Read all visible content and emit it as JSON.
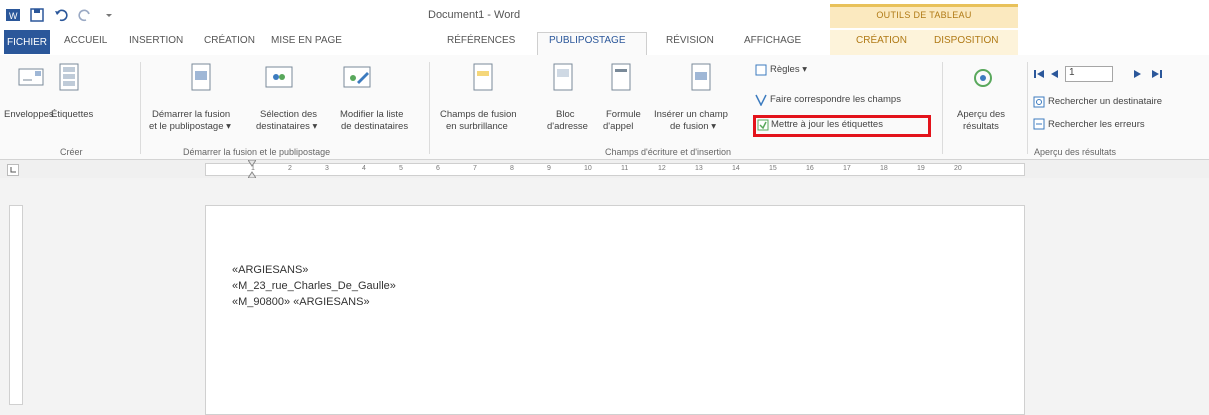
{
  "window": {
    "title": "Document1 - Word",
    "contextual_label": "OUTILS DE TABLEAU"
  },
  "tabs": [
    "FICHIER",
    "ACCUEIL",
    "INSERTION",
    "CRÉATION",
    "MISE EN PAGE",
    "RÉFÉRENCES",
    "PUBLIPOSTAGE",
    "RÉVISION",
    "AFFICHAGE",
    "CRÉATION",
    "DISPOSITION"
  ],
  "ribbon": {
    "create": {
      "envelopes": "Enveloppes",
      "labels": "Étiquettes",
      "group": "Créer"
    },
    "start": {
      "start_merge": [
        "Démarrer la fusion",
        "et le publipostage ▾"
      ],
      "select_recipients": [
        "Sélection des",
        "destinataires ▾"
      ],
      "edit_list": [
        "Modifier la liste",
        "de destinataires"
      ],
      "group": "Démarrer la fusion et le publipostage"
    },
    "fields": {
      "highlight": [
        "Champs de fusion",
        "en surbrillance"
      ],
      "address_block": [
        "Bloc",
        "d'adresse"
      ],
      "greeting": [
        "Formule",
        "d'appel"
      ],
      "insert_field": [
        "Insérer un champ",
        "de fusion ▾"
      ],
      "rules": "Règles ▾",
      "match_fields": "Faire correspondre les champs",
      "update_labels": "Mettre à jour les étiquettes",
      "group": "Champs d'écriture et d'insertion"
    },
    "preview": {
      "preview_results": [
        "Aperçu des",
        "résultats"
      ],
      "record_number": "1",
      "find_recipient": "Rechercher un destinataire",
      "check_errors": "Rechercher les erreurs",
      "group": "Aperçu des résultats"
    }
  },
  "ruler": {
    "ticks": [
      "1",
      "2",
      "3",
      "4",
      "5",
      "6",
      "7",
      "8",
      "9",
      "10",
      "11",
      "12",
      "13",
      "14",
      "15",
      "16",
      "17",
      "18",
      "19",
      "20"
    ]
  },
  "document": {
    "lines": [
      "«ARGIESANS»",
      "«M_23_rue_Charles_De_Gaulle»",
      "«M_90800» «ARGIESANS»"
    ]
  },
  "colors": {
    "accent": "#2b579a",
    "highlight": "#e3131b"
  }
}
